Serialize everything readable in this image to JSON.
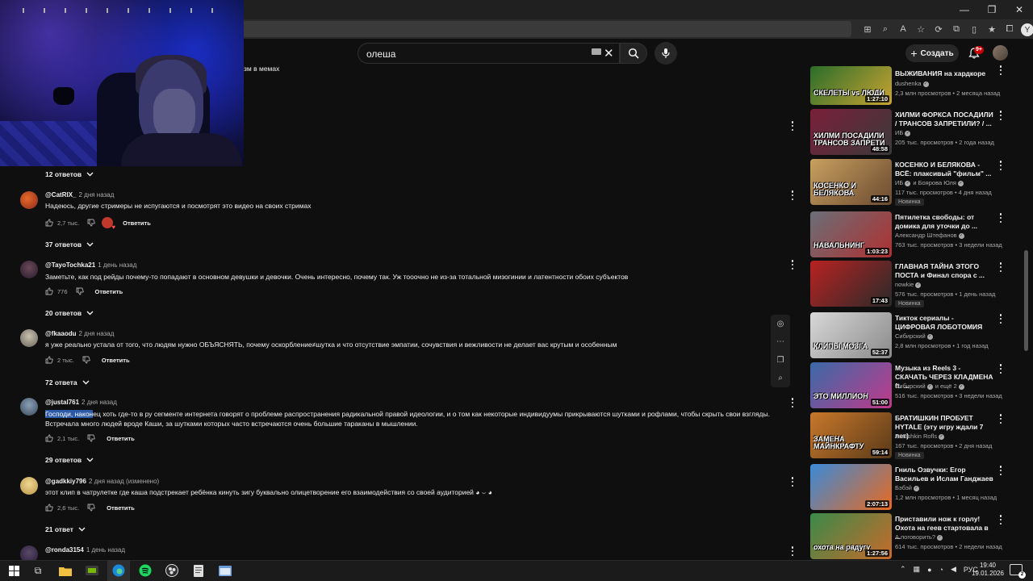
{
  "browser": {
    "window_controls": {
      "minimize": "—",
      "restore": "❐",
      "close": "✕"
    },
    "profile_initial": "Y"
  },
  "youtube": {
    "search": {
      "query": "олеша"
    },
    "create_label": "Создать",
    "notifications_badge": "9+",
    "partial_text_top": "зм в мемах"
  },
  "comments": [
    {
      "replies": "12 ответов"
    },
    {
      "author": "@CatRIX_",
      "time": "2 дня назад",
      "text": "Надеюсь, другие стримеры не испугаются и посмотрят это видео на своих стримах",
      "likes": "2,7 тыс.",
      "reply": "Ответить",
      "replies": "37 ответов"
    },
    {
      "author": "@TayoTochka21",
      "time": "1 день назад",
      "text": "Заметьте, как под рейды почему-то попадают в основном девушки и девочки. Очень интересно, почему так. Уж тооочно не из-за тотальной мизогинии и латентности обоих субъектов",
      "likes": "776",
      "reply": "Ответить",
      "replies": "20 ответов"
    },
    {
      "author": "@fkaaodu",
      "time": "2 дня назад",
      "text": "я уже реально устала от того, что людям нужно ОБЪЯСНЯТЬ, почему оскорбление≠шутка и что отсутствие эмпатии, сочувствия и вежливости не делает вас крутым и особенным",
      "likes": "2 тыс.",
      "reply": "Ответить",
      "replies": "72 ответа"
    },
    {
      "author": "@justal761",
      "time": "2 дня назад",
      "text_highlight": "Господи, након",
      "text": "ец хоть где-то в ру сегменте интернета говорят о проблеме распространения радикальной правой идеологии, и о том как некоторые индивидуумы прикрываются шутками и рофлами, чтобы скрыть свои взгляды. Встречала много людей вроде Каши, за шутками которых часто встречаются очень большие тараканы в мышлении.",
      "likes": "2,1 тыс.",
      "reply": "Ответить",
      "replies": "29 ответов"
    },
    {
      "author": "@gadkkiy796",
      "time": "2 дня назад (изменено)",
      "text": "этот клип в чатрулетке где каша подстрекает ребёнка кинуть зигу буквально олицетворение его взаимодействия со своей аудиторией ◕ ⌣ ◕",
      "likes": "2,6 тыс.",
      "reply": "Ответить",
      "replies": "21 ответ"
    },
    {
      "author": "@ronda3154",
      "time": "1 день назад"
    }
  ],
  "videos": [
    {
      "thumb_text": "СКЕЛЕТЫ vs ЛЮДИ",
      "duration": "1:27:10",
      "title": "ВЫЖИВАНИЯ на хардкоре",
      "channel": "dushenka",
      "meta": "2,3 млн просмотров • 2 месяца назад",
      "colors": [
        "#2a6d2a",
        "#c9a332"
      ]
    },
    {
      "thumb_text": "ХИЛМИ ПОСАДИЛИ ТРАНСОВ ЗАПРЕТИ",
      "duration": "48:58",
      "title": "ХИЛМИ ФОРКСА ПОСАДИЛИ / ТРАНСОВ ЗАПРЕТИЛИ? / ...",
      "channel": "ИБ",
      "meta": "205 тыс. просмотров • 2 года назад",
      "colors": [
        "#7a1f3a",
        "#3a3a3a"
      ]
    },
    {
      "thumb_text": "КОСЕНКО И БЕЛЯКОВА",
      "duration": "44:16",
      "title": "КОСЕНКО И БЕЛЯКОВА - ВСЁ: плаксивый \"фильм\" ...",
      "channel": "ИБ",
      "channel_extra": "и Боярова Юля",
      "meta": "117 тыс. просмотров • 4 дня назад",
      "badge": "Новинка",
      "colors": [
        "#c8a060",
        "#6b4a30"
      ]
    },
    {
      "thumb_text": "НАВАЛЬНИНГ",
      "duration": "1:03:23",
      "title": "Пятилетка свободы: от домика для уточки до ...",
      "channel": "Александр Штефанов",
      "meta": "763 тыс. просмотров • 3 недели назад",
      "colors": [
        "#6a6f78",
        "#b03030"
      ]
    },
    {
      "thumb_text": "",
      "duration": "17:43",
      "title": "ГЛАВНАЯ ТАЙНА ЭТОГО ПОСТА и Финал спора с ...",
      "channel": "nowkie",
      "meta": "576 тыс. просмотров • 1 день назад",
      "badge": "Новинка",
      "colors": [
        "#b82222",
        "#2a2a2a"
      ]
    },
    {
      "thumb_text": "КЛИПЫ МОЗГА",
      "duration": "52:37",
      "title": "Тикток сериалы - ЦИФРОВАЯ ЛОБОТОМИЯ",
      "channel": "Сибирский",
      "meta": "2,8 млн просмотров • 1 год назад",
      "colors": [
        "#d8d8d8",
        "#8a8a8a"
      ]
    },
    {
      "thumb_text": "ЭТО МИЛЛИОН",
      "duration": "51:00",
      "title": "Музыка из Reels 3 - СКАЧАТЬ ЧЕРЕЗ КЛАДМЕНА ft. ...",
      "channel": "Сибирский",
      "channel_extra": "и ещё 2",
      "meta": "516 тыс. просмотров • 3 недели назад",
      "colors": [
        "#3a6aa8",
        "#c03a8a"
      ]
    },
    {
      "thumb_text": "ЗАМЕНА МАЙНКРАФТУ",
      "duration": "59:14",
      "title": "БРАТИШКИН ПРОБУЕТ HYTALE (эту игру ждали 7 лет)",
      "channel": "Bratishkin Rofls",
      "meta": "167 тыс. просмотров • 2 дня назад",
      "badge": "Новинка",
      "colors": [
        "#c8782a",
        "#5a3a1a"
      ]
    },
    {
      "thumb_text": "",
      "duration": "2:07:13",
      "title": "Гниль Озвучки: Егор Васильев и Ислам Ганджаев",
      "channel": "Бэбэй",
      "meta": "1,2 млн просмотров • 1 месяц назад",
      "colors": [
        "#3a8ad8",
        "#e86a20"
      ]
    },
    {
      "thumb_text": "охота на радугу",
      "duration": "1:27:56",
      "title": "Приставили нож к горлу! Охота на геев стартовала в ...",
      "channel": "А поговорить?",
      "meta": "614 тыс. просмотров • 2 недели назад",
      "colors": [
        "#3a8a4a",
        "#c86a2a"
      ]
    }
  ],
  "taskbar": {
    "lang": "РУС",
    "time": "19:40",
    "date": "19.01.2026",
    "notif_count": "2"
  }
}
